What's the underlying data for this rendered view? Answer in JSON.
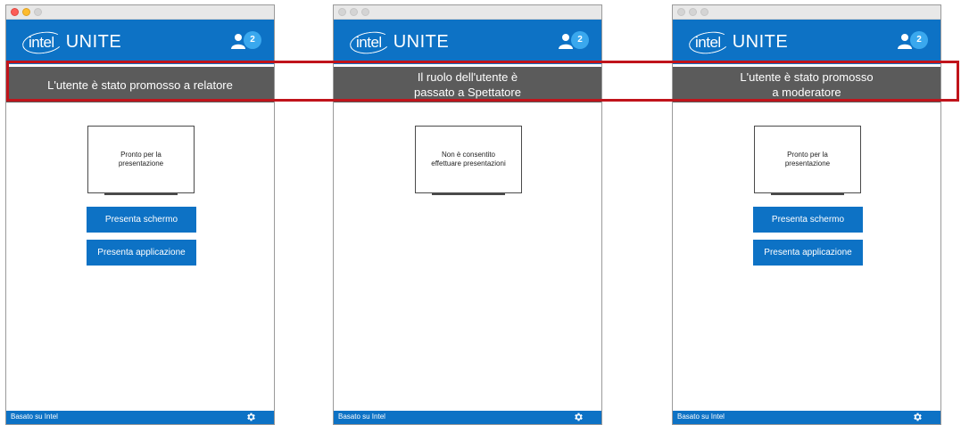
{
  "app": {
    "logo_mark": "intel",
    "app_name": "UNITE",
    "participant_count": "2",
    "footer_label": "Basato su Intel",
    "colors": {
      "primary": "#0d72c5",
      "badge": "#3aa8ee",
      "notification_bg": "#5b5b5b",
      "highlight": "#c0141b"
    },
    "icons": {
      "participants": "user-icon",
      "settings": "gear-icon"
    }
  },
  "windows": [
    {
      "notification": "L'utente è stato promosso a relatore",
      "screen_status": "Pronto per la\npresentazione",
      "buttons": {
        "present_screen": "Presenta schermo",
        "present_app": "Presenta applicazione"
      }
    },
    {
      "notification": "Il ruolo dell'utente è\npassato a Spettatore",
      "screen_status": "Non è consentito\neffettuare presentazioni"
    },
    {
      "notification": "L'utente è stato promosso\na moderatore",
      "screen_status": "Pronto per la\npresentazione",
      "buttons": {
        "present_screen": "Presenta schermo",
        "present_app": "Presenta applicazione"
      }
    }
  ]
}
